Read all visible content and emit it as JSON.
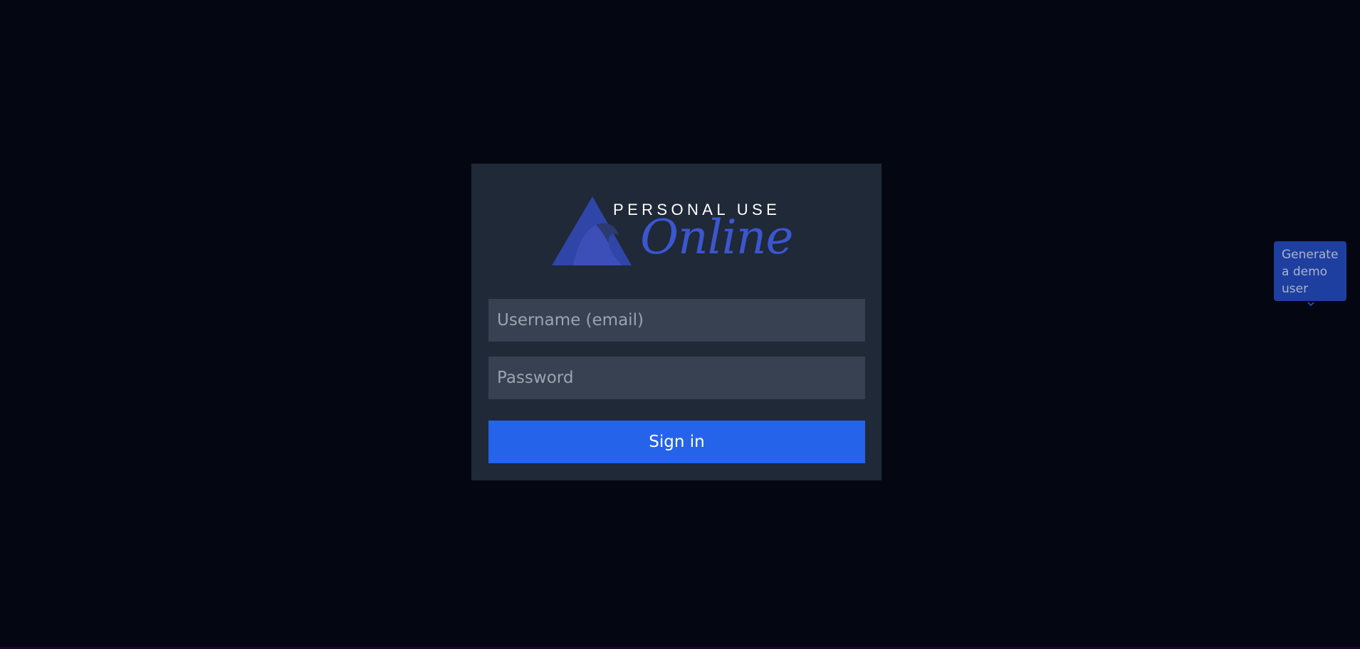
{
  "logo": {
    "top_text": "PERSONAL USE",
    "script_text": "Online",
    "mark_icon": "mountain-wave-icon",
    "accent_color": "#2f45a8"
  },
  "login": {
    "username_placeholder": "Username (email)",
    "password_placeholder": "Password",
    "signin_label": "Sign in"
  },
  "demo": {
    "label": "Generate a demo user",
    "chevron_icon": "chevron-down-icon"
  },
  "colors": {
    "background": "#040712",
    "card": "#1f2937",
    "field": "#374151",
    "primary": "#2563eb",
    "demo_button": "#1e3fa0"
  }
}
